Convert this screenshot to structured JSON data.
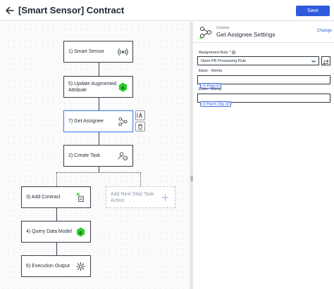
{
  "header": {
    "title": "[Smart Sensor] Contract",
    "save_label": "Save"
  },
  "flow": {
    "nodes": [
      {
        "label": "1) Smart Sensor",
        "icon": "sensor-icon"
      },
      {
        "label": "5) Update Augmented Attribute",
        "icon": "celonis-c-icon"
      },
      {
        "label": "7) Get Assignee",
        "icon": "assignee-network-icon"
      },
      {
        "label": "2) Create Task",
        "icon": "create-task-icon"
      },
      {
        "label": "3) Add Contract",
        "icon": "add-contract-icon"
      },
      {
        "label": "4) Query Data Model",
        "icon": "celonis-c-icon"
      },
      {
        "label": "6) Execution Output",
        "icon": "gear-icon"
      }
    ],
    "placeholder_label": "Add Next Step Task Action",
    "side_actions": [
      "text-field-icon",
      "trash-icon"
    ]
  },
  "panel": {
    "subtitle": "Celonis",
    "title": "Get Assignee Settings",
    "change_label": "Change",
    "assignment_rule_label": "Assignment Rule *",
    "assignment_rule_value": "Open PR Processing Rule",
    "fields": [
      {
        "label": "Eban - Werks",
        "chip": "Plant ID"
      },
      {
        "label": "Eban - Ekorg",
        "chip": "Purch. Org. ID"
      }
    ]
  },
  "colors": {
    "primary": "#2d5bdc",
    "celonis_green": "#2ccf2c",
    "node_border": "#353f4b",
    "selected_border": "#4c82e6"
  }
}
